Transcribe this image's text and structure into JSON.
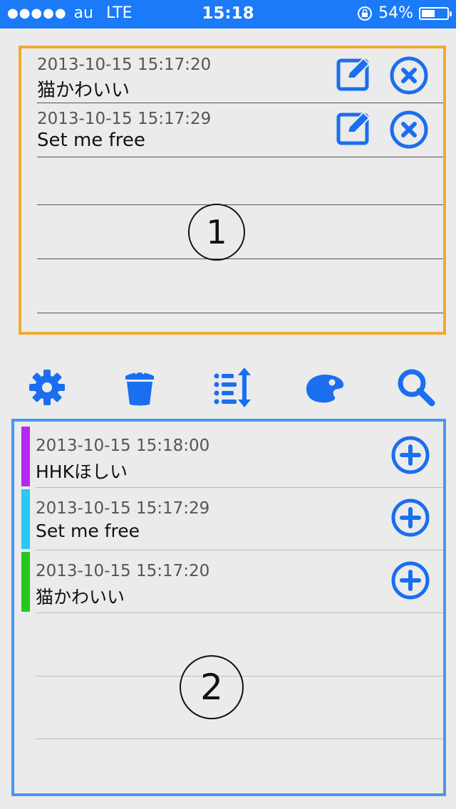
{
  "status_bar": {
    "signal_dots": "●●●●●",
    "carrier": "au",
    "network": "LTE",
    "time": "15:18",
    "battery_percent": "54%",
    "battery_level": 0.54
  },
  "panel1": {
    "items": [
      {
        "timestamp": "2013-10-15 15:17:20",
        "text": "猫かわいい"
      },
      {
        "timestamp": "2013-10-15 15:17:29",
        "text": "Set me free"
      }
    ],
    "marker": "1"
  },
  "toolbar": {
    "icons": [
      "gear-icon",
      "trash-icon",
      "sort-icon",
      "palette-icon",
      "search-icon"
    ]
  },
  "panel2": {
    "items": [
      {
        "timestamp": "2013-10-15 15:18:00",
        "text": "HHKほしい",
        "color": "#b429f0"
      },
      {
        "timestamp": "2013-10-15 15:17:29",
        "text": "Set me free",
        "color": "#29c8f5"
      },
      {
        "timestamp": "2013-10-15 15:17:20",
        "text": "猫かわいい",
        "color": "#26c81e"
      }
    ],
    "marker": "2"
  },
  "colors": {
    "accent": "#1a6ef0",
    "status_bar": "#1a7af8",
    "panel1_border": "#f1a92f",
    "panel2_border": "#4996f2"
  }
}
